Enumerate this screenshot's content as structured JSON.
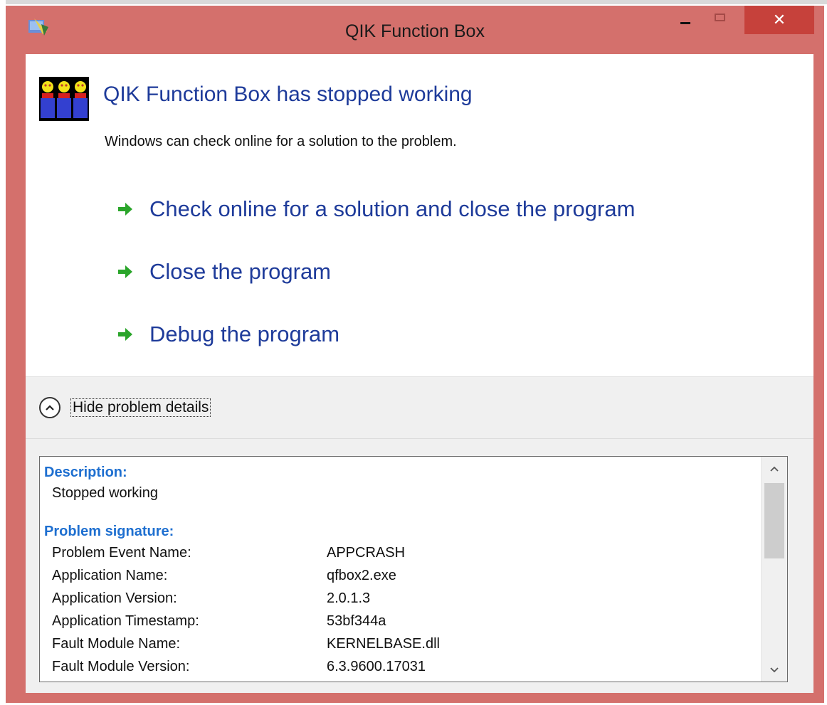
{
  "window": {
    "title": "QIK Function Box",
    "close_glyph": "✕"
  },
  "dialog": {
    "heading": "QIK Function Box has stopped working",
    "subtext": "Windows can check online for a solution to the problem.",
    "options": [
      {
        "label": "Check online for a solution and close the program",
        "icon": "green-arrow-icon"
      },
      {
        "label": "Close the program",
        "icon": "green-arrow-icon"
      },
      {
        "label": "Debug the program",
        "icon": "green-arrow-icon"
      }
    ],
    "details_toggle": "Hide problem details"
  },
  "details": {
    "description_title": "Description:",
    "description_text": "Stopped working",
    "signature_title": "Problem signature:",
    "signature_rows": [
      {
        "key": "Problem Event Name:",
        "value": "APPCRASH"
      },
      {
        "key": "Application Name:",
        "value": "qfbox2.exe"
      },
      {
        "key": "Application Version:",
        "value": "2.0.1.3"
      },
      {
        "key": "Application Timestamp:",
        "value": "53bf344a"
      },
      {
        "key": "Fault Module Name:",
        "value": "KERNELBASE.dll"
      },
      {
        "key": "Fault Module Version:",
        "value": "6.3.9600.17031"
      }
    ]
  },
  "colors": {
    "frame": "#d4706c",
    "close_button": "#c6413b",
    "link_blue": "#1e3b9a",
    "section_blue": "#1e6fd0",
    "arrow_green": "#2aa52a"
  }
}
